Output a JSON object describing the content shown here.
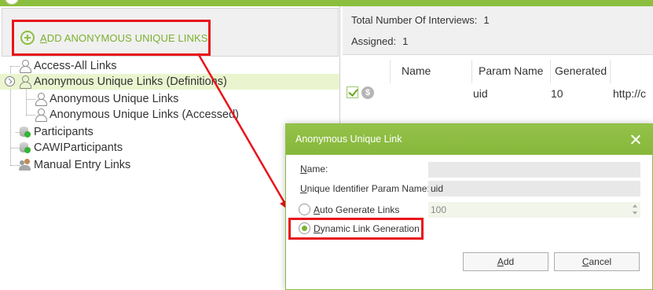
{
  "toolbar": {
    "add_link_accel": "A",
    "add_link_rest": "DD ANONYMOUS UNIQUE LINKS"
  },
  "tree": {
    "items": [
      {
        "label": "Access-All Links",
        "icon": "person-icon"
      },
      {
        "label": "Anonymous Unique Links (Definitions)",
        "icon": "person-icon",
        "selected": true
      },
      {
        "label": "Anonymous Unique Links",
        "icon": "person-icon"
      },
      {
        "label": "Anonymous Unique Links (Accessed)",
        "icon": "person-icon"
      },
      {
        "label": "Participants",
        "icon": "database-icon"
      },
      {
        "label": "CAWIParticipants",
        "icon": "database-icon"
      },
      {
        "label": "Manual Entry Links",
        "icon": "group-icon"
      }
    ]
  },
  "info": {
    "total_label": "Total Number Of Interviews:",
    "total_value": "1",
    "assigned_label": "Assigned:",
    "assigned_value": "1"
  },
  "grid": {
    "columns": [
      "Name",
      "Param Name",
      "Generated"
    ],
    "rows": [
      {
        "checked": true,
        "name": "",
        "param_name": "uid",
        "generated": "10",
        "url": "http://c"
      }
    ]
  },
  "dialog": {
    "title": "Anonymous Unique Link",
    "name_label": "Name:",
    "name_accel": "N",
    "name_value": "",
    "param_label_accel": "U",
    "param_label_rest": "nique Identifier Param Name:",
    "param_value": "uid",
    "auto_gen_accel": "A",
    "auto_gen_rest": "uto Generate Links",
    "auto_gen_value": "100",
    "dynamic_accel": "D",
    "dynamic_rest": "ynamic Link Generation",
    "dynamic_selected": true,
    "add_accel": "A",
    "add_rest": "dd",
    "cancel_accel": "C",
    "cancel_rest": "ancel"
  },
  "colors": {
    "accent": "#8cbf3f",
    "highlight_red": "#e8141a",
    "selected_row": "#eaf5cf"
  }
}
